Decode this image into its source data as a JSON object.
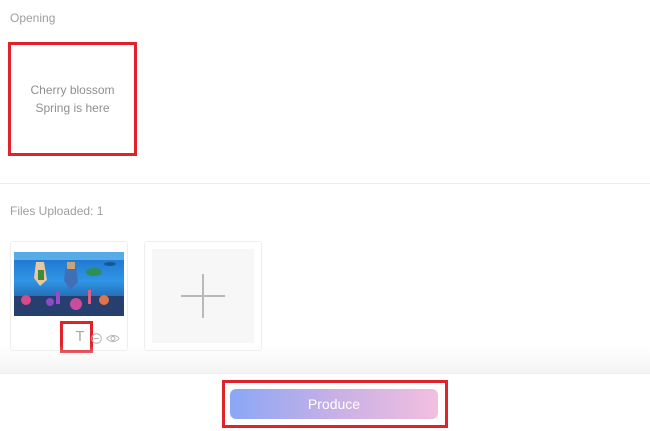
{
  "opening": {
    "label": "Opening",
    "line1": "Cherry blossom",
    "line2": "Spring is here"
  },
  "files": {
    "uploaded_label": "Files Uploaded: 1",
    "items": [
      {
        "thumbnail": "underwater-game-scene-image",
        "text_tool": "T"
      }
    ]
  },
  "icons": {
    "text_tool": "text-icon",
    "remove": "minus-circle-icon",
    "preview": "eye-icon",
    "add": "plus-icon"
  },
  "footer": {
    "produce_label": "Produce"
  },
  "colors": {
    "highlight": "#e0232a",
    "button_gradient_start": "#8aa7f6",
    "button_gradient_end": "#f2bfdf"
  }
}
